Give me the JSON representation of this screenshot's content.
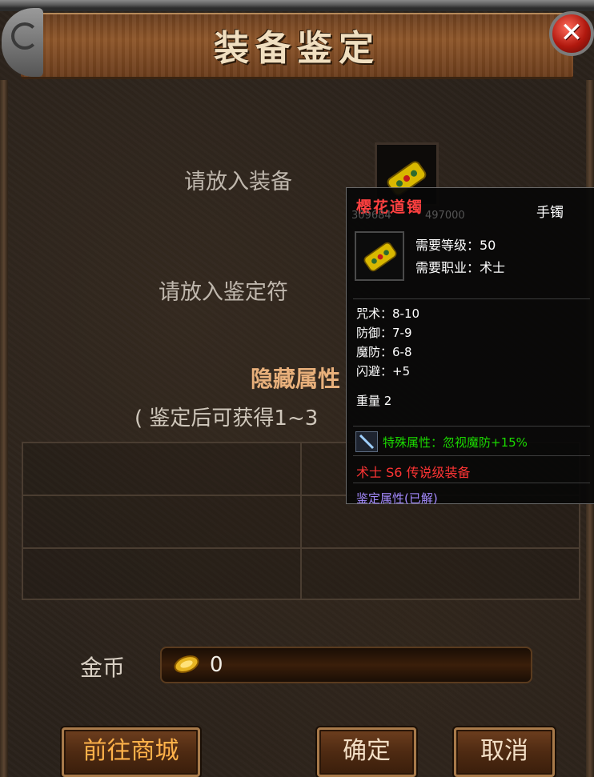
{
  "window": {
    "title": "装备鉴定",
    "close_symbol": "✕"
  },
  "slots": {
    "equipment_label": "请放入装备",
    "talisman_label": "请放入鉴定符"
  },
  "hidden": {
    "title": "隐藏属性",
    "subtitle": "( 鉴定后可获得1~3"
  },
  "gold": {
    "label": "金币",
    "value": "0",
    "icon": "gold-coin-icon"
  },
  "buttons": {
    "shop": "前往商城",
    "confirm": "确定",
    "cancel": "取消"
  },
  "tooltip": {
    "name": "樱花道镯",
    "type": "手镯",
    "ghost_left": "309684",
    "ghost_right": "497000",
    "req_level": "需要等级：50",
    "req_class": "需要职业：术士",
    "stats": [
      "咒术：8-10",
      "防御：7-9",
      "魔防：6-8",
      "闪避：+5"
    ],
    "weight": "重量  2",
    "special": "特殊属性：忽视魔防+15%",
    "legend": "术士  S6  传说级装备",
    "identify": "鉴定属性(已解)"
  },
  "colors": {
    "item_name": "#ff4040",
    "special": "#1bd900",
    "legend": "#ff3434",
    "identify": "#a58bff",
    "shop_button_text": "#ffb24a"
  }
}
